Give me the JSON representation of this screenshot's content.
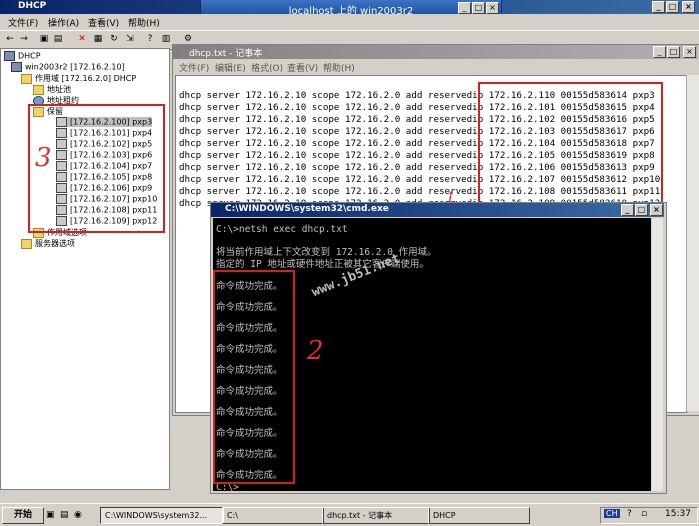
{
  "dhcp_window": {
    "title": "DHCP",
    "menu": [
      "文件(F)",
      "操作(A)",
      "查看(V)",
      "帮助(H)"
    ]
  },
  "remote_bar": {
    "title": "localhost 上的 win2003r2"
  },
  "tree": {
    "root": "DHCP",
    "server": "win2003r2 [172.16.2.10]",
    "scope": "作用域 [172.16.2.0] DHCP",
    "pool": "地址池",
    "leases": "地址租约",
    "reservations": "保留",
    "items": [
      "[172.16.2.100] pxp3",
      "[172.16.2.101] pxp4",
      "[172.16.2.102] pxp5",
      "[172.16.2.103] pxp6",
      "[172.16.2.104] pxp7",
      "[172.16.2.105] pxp8",
      "[172.16.2.106] pxp9",
      "[172.16.2.107] pxp10",
      "[172.16.2.108] pxp11",
      "[172.16.2.109] pxp12"
    ],
    "scope_options": "作用域选项",
    "server_options": "服务器选项"
  },
  "notepad": {
    "title": "dhcp.txt - 记事本",
    "menu": [
      "文件(F)",
      "编辑(E)",
      "格式(O)",
      "查看(V)",
      "帮助(H)"
    ],
    "lines": [
      "dhcp server 172.16.2.10 scope 172.16.2.0 add reservedip 172.16.2.110 00155d583614 pxp3",
      "dhcp server 172.16.2.10 scope 172.16.2.0 add reservedip 172.16.2.101 00155d583615 pxp4",
      "dhcp server 172.16.2.10 scope 172.16.2.0 add reservedip 172.16.2.102 00155d583616 pxp5",
      "dhcp server 172.16.2.10 scope 172.16.2.0 add reservedip 172.16.2.103 00155d583617 pxp6",
      "dhcp server 172.16.2.10 scope 172.16.2.0 add reservedip 172.16.2.104 00155d583618 pxp7",
      "dhcp server 172.16.2.10 scope 172.16.2.0 add reservedip 172.16.2.105 00155d583619 pxp8",
      "dhcp server 172.16.2.10 scope 172.16.2.0 add reservedip 172.16.2.106 00155d583613 pxp9",
      "dhcp server 172.16.2.10 scope 172.16.2.0 add reservedip 172.16.2.107 00155d583612 pxp10",
      "dhcp server 172.16.2.10 scope 172.16.2.0 add reservedip 172.16.2.108 00155d583611 pxp11",
      "dhcp server 172.16.2.10 scope 172.16.2.0 add reservedip 172.16.2.109 00155d583610 pxp12"
    ]
  },
  "cmd": {
    "title": "C:\\WINDOWS\\system32\\cmd.exe",
    "command": "C:\\>netsh exec dhcp.txt",
    "context_msg_1": "将当前作用域上下文改变到 172.16.2.0 作用域。",
    "context_msg_2": "指定的 IP 地址或硬件地址正被其它客户端使用。",
    "success": [
      "命令成功完成。",
      "命令成功完成。",
      "命令成功完成。",
      "命令成功完成。",
      "命令成功完成。",
      "命令成功完成。",
      "命令成功完成。",
      "命令成功完成。",
      "命令成功完成。",
      "命令成功完成。"
    ],
    "prompt": "C:\\>_"
  },
  "annotations": {
    "one": "1",
    "two": "2",
    "three": "3"
  },
  "watermark": "www.jb51.net",
  "taskbar": {
    "start": "开始",
    "tasks": [
      "C:\\WINDOWS\\system32...",
      "C:\\",
      "dhcp.txt - 记事本",
      "DHCP"
    ],
    "lang": "CH",
    "time": "15:37"
  }
}
